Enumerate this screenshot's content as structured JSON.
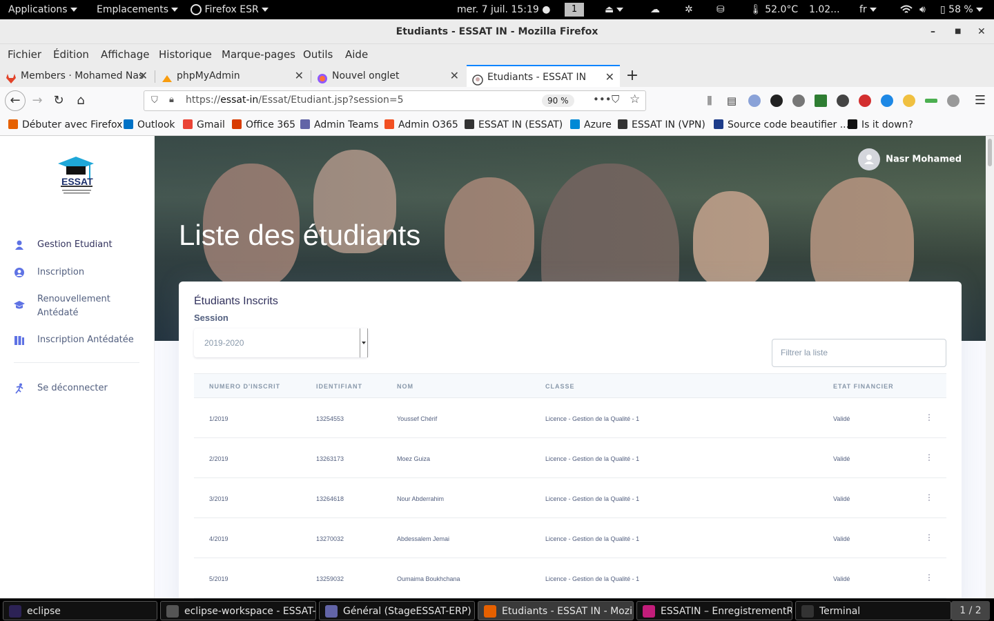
{
  "topbar": {
    "applications": "Applications",
    "places": "Emplacements",
    "firefox": "Firefox ESR",
    "datetime": "mer. 7 juil.  15:19",
    "workspace": "1",
    "temperature": "52.0°C",
    "cpu": "1.02...",
    "lang": "fr",
    "battery": "58 %"
  },
  "window": {
    "title": "Etudiants - ESSAT IN - Mozilla Firefox"
  },
  "menu": [
    "Fichier",
    "Édition",
    "Affichage",
    "Historique",
    "Marque-pages",
    "Outils",
    "Aide"
  ],
  "tabs": [
    {
      "label": "Members · Mohamed Nas",
      "color": "#e24329"
    },
    {
      "label": "phpMyAdmin",
      "color": "#f89c0e"
    },
    {
      "label": "Nouvel onglet",
      "color": "#9059ff"
    },
    {
      "label": "Etudiants - ESSAT IN",
      "color": "#444444"
    }
  ],
  "url": {
    "scheme": "https://",
    "host": "essat-in",
    "path": "/Essat/Etudiant.jsp?session=5",
    "zoom": "90 %"
  },
  "bookmarks": [
    {
      "label": "Débuter avec Firefox",
      "color": "#e66000"
    },
    {
      "label": "Outlook",
      "color": "#0072c6"
    },
    {
      "label": "Gmail",
      "color": "#ea4335"
    },
    {
      "label": "Office 365",
      "color": "#d83b01"
    },
    {
      "label": "Admin Teams",
      "color": "#6264a7"
    },
    {
      "label": "Admin O365",
      "color": "#f25022"
    },
    {
      "label": "ESSAT IN (ESSAT)",
      "color": "#333333"
    },
    {
      "label": "Azure",
      "color": "#0089d6"
    },
    {
      "label": "ESSAT IN (VPN)",
      "color": "#333333"
    },
    {
      "label": "Source code beautifier ...",
      "color": "#1d3c8a"
    },
    {
      "label": "Is it down?",
      "color": "#111111"
    }
  ],
  "sidebar": {
    "logo_text": "ESSAT",
    "items": [
      {
        "label": "Gestion Etudiant",
        "icon": "user-icon",
        "color": "#5e72e4"
      },
      {
        "label": "Inscription",
        "icon": "user-circle-icon",
        "color": "#5e72e4"
      },
      {
        "label": "Renouvellement Antédaté",
        "icon": "graduation-cap-icon",
        "color": "#5e72e4"
      },
      {
        "label": "Inscription Antédatée",
        "icon": "books-icon",
        "color": "#5e72e4"
      },
      {
        "label": "Se déconnecter",
        "icon": "running-icon",
        "color": "#5e72e4"
      }
    ]
  },
  "header": {
    "page_title": "Liste des étudiants",
    "user_name": "Nasr Mohamed"
  },
  "card": {
    "title": "Étudiants Inscrits",
    "session_label": "Session",
    "session_value": "2019-2020",
    "filter_placeholder": "Filtrer la liste"
  },
  "table": {
    "columns": [
      "Numero d'inscrit",
      "Identifiant",
      "Nom",
      "Classe",
      "Etat financier"
    ],
    "rows": [
      [
        "1/2019",
        "13254553",
        "Youssef Chérif",
        "Licence - Gestion de la Qualité - 1",
        "Validé"
      ],
      [
        "2/2019",
        "13263173",
        "Moez Guiza",
        "Licence - Gestion de la Qualité - 1",
        "Validé"
      ],
      [
        "3/2019",
        "13264618",
        "Nour Abderrahim",
        "Licence - Gestion de la Qualité - 1",
        "Validé"
      ],
      [
        "4/2019",
        "13270032",
        "Abdessalem Jemai",
        "Licence - Gestion de la Qualité - 1",
        "Validé"
      ],
      [
        "5/2019",
        "13259032",
        "Oumaima Boukhchana",
        "Licence - Gestion de la Qualité - 1",
        "Validé"
      ]
    ]
  },
  "taskbar": {
    "tasks": [
      {
        "label": "eclipse",
        "color": "#2c2255"
      },
      {
        "label": "eclipse-workspace - ESSAT-...",
        "color": "#555555"
      },
      {
        "label": "Général (StageESSAT-ERP) | ...",
        "color": "#6264a7"
      },
      {
        "label": "Etudiants - ESSAT IN - Mozil...",
        "color": "#e66000"
      },
      {
        "label": "ESSATIN – EnregistrementR...",
        "color": "#c21d7a"
      },
      {
        "label": "Terminal",
        "color": "#333333"
      }
    ],
    "workspace": "1 / 2"
  }
}
